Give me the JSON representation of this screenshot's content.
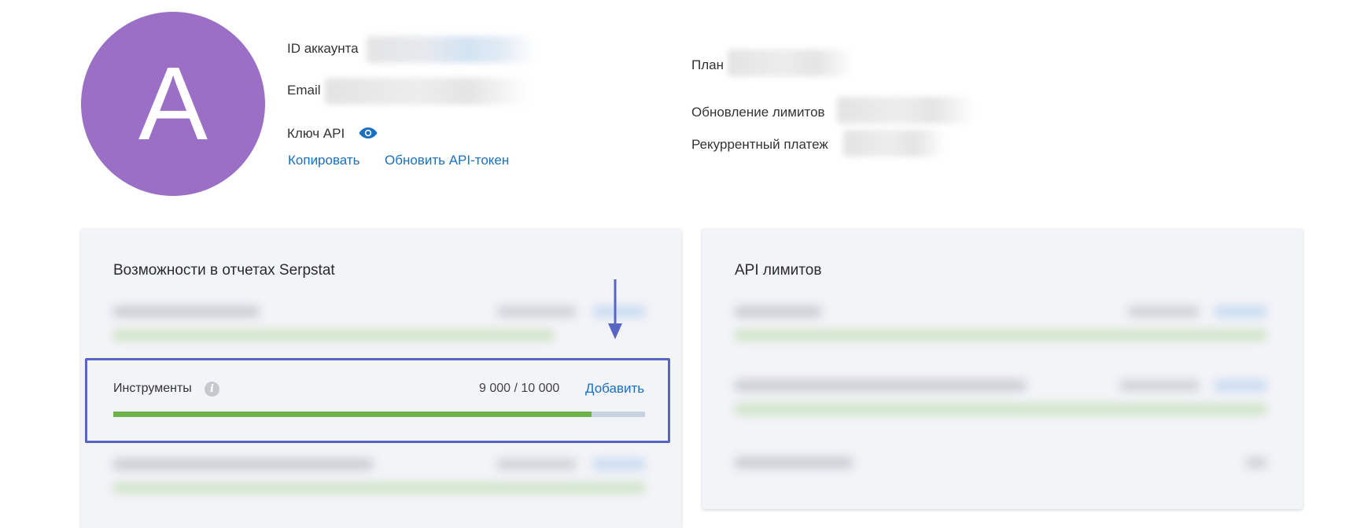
{
  "profile": {
    "avatar_letter": "A",
    "account_id_label": "ID аккаунта",
    "email_label": "Email",
    "api_key_label": "Ключ API",
    "copy_link": "Копировать",
    "refresh_token_link": "Обновить API-токен",
    "plan_label": "План",
    "limits_update_label": "Обновление лимитов",
    "recurring_payment_label": "Рекуррентный платеж"
  },
  "cards": {
    "reports": {
      "title": "Возможности в отчетах Serpstat",
      "tools": {
        "label": "Инструменты",
        "used": 9000,
        "total": 10000,
        "count_text": "9 000 / 10 000",
        "add_link": "Добавить"
      }
    },
    "api": {
      "title": "API лимитов"
    }
  },
  "colors": {
    "avatar": "#9a6fc5",
    "link": "#1a6fbf",
    "progress_fill": "#6db24a",
    "progress_track": "#c9d3df",
    "highlight_border": "#5965c5",
    "card_bg": "#f3f4f8"
  },
  "icons": [
    "eye-icon",
    "info-icon",
    "arrow-down-icon"
  ]
}
